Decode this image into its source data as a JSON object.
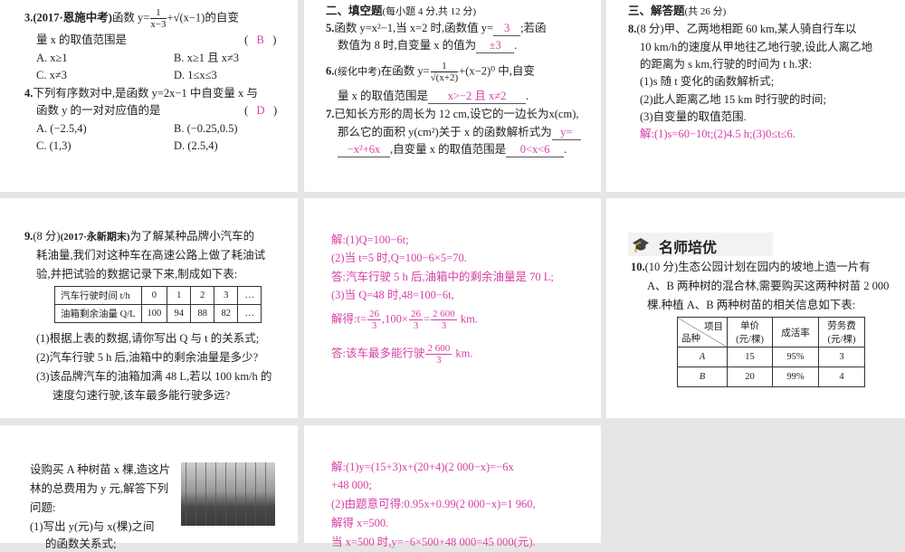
{
  "q3": {
    "head": "3.",
    "src": "(2017·恩施中考)",
    "stem1a": "函数 y=",
    "num": "1",
    "den": "x−3",
    "stem1b": "+√(x−1)的自变",
    "stem2": "量 x 的取值范围是",
    "answer": "B",
    "optA": "A. x≥1",
    "optB": "B. x≥1 且 x≠3",
    "optC": "C. x≠3",
    "optD": "D. 1≤x≤3"
  },
  "q4": {
    "head": "4.",
    "stem1": "下列有序数对中,是函数 y=2x−1 中自变量 x 与",
    "stem2": "函数 y 的一对对应值的是",
    "answer": "D",
    "optA": "A. (−2.5,4)",
    "optB": "B. (−0.25,0.5)",
    "optC": "C. (1,3)",
    "optD": "D. (2.5,4)"
  },
  "sec2": {
    "title": "二、填空题",
    "note": "(每小题 4 分,共 12 分)"
  },
  "q5": {
    "head": "5.",
    "l1a": "函数 y=x²−1,当 x=2 时,函数值 y=",
    "a1": "3",
    "l1b": ";若函",
    "l2a": "数值为 8 时,自变量 x 的值为",
    "a2": "±3",
    "l2b": "."
  },
  "q6": {
    "head": "6.",
    "src": "(绥化中考)",
    "l1a": "在函数 y=",
    "num": "1",
    "den": "√(x+2)",
    "l1b": "+(x−2)⁰ 中,自变",
    "l2a": "量 x 的取值范围是",
    "a1": "x>−2 且 x≠2",
    "l2b": "."
  },
  "q7": {
    "head": "7.",
    "l1": "已知长方形的周长为 12 cm,设它的一边长为x(cm),",
    "l2a": "那么它的面积 y(cm²)关于 x 的函数解析式为",
    "a1a": "y=",
    "a1b": "−x²+6x",
    "l3b": ",自变量 x 的取值范围是",
    "a2": "0<x<6",
    "l3c": "."
  },
  "sec3": {
    "title": "三、解答题",
    "note": "(共 26 分)"
  },
  "q8": {
    "head": "8.",
    "l1": "(8 分)甲、乙两地相距 60 km,某人骑自行车以",
    "l2": "10 km/h的速度从甲地往乙地行驶,设此人离乙地",
    "l3": "的距离为 s km,行驶的时间为 t h.求:",
    "p1": "(1)s 随 t 变化的函数解析式;",
    "p2": "(2)此人距离乙地 15 km 时行驶的时间;",
    "p3": "(3)自变量的取值范围.",
    "sol": "解:(1)s=60−10t;(2)4.5 h;(3)0≤t≤6."
  },
  "q9": {
    "head": "9.",
    "l1a": "(8 分)",
    "src": "(2017·永新期末)",
    "l1b": "为了解某种品牌小汽车的",
    "l2": "耗油量,我们对这种车在高速公路上做了耗油试",
    "l3": "验,并把试验的数据记录下来,制成如下表:",
    "table": {
      "row1": [
        "汽车行驶时间 t/h",
        "0",
        "1",
        "2",
        "3",
        "…"
      ],
      "row2": [
        "油箱剩余油量 Q/L",
        "100",
        "94",
        "88",
        "82",
        "…"
      ]
    },
    "p1": "(1)根据上表的数据,请你写出 Q 与 t 的关系式;",
    "p2": "(2)汽车行驶 5 h 后,油箱中的剩余油量是多少?",
    "p3": "(3)该品牌汽车的油箱加满 48 L,若以 100 km/h 的",
    "p3b": "速度匀速行驶,该车最多能行驶多远?"
  },
  "sol9": {
    "l1": "解:(1)Q=100−6t;",
    "l2": "(2)当 t=5 时,Q=100−6×5=70.",
    "l3": "答:汽车行驶 5 h 后,油箱中的剩余油量是 70 L;",
    "l4": "(3)当 Q=48 时,48=100−6t,",
    "l5a": "解得:t=",
    "n1": "26",
    "d1": "3",
    "l5b": ",100×",
    "n2": "26",
    "d2": "3",
    "l5c": "=",
    "n3": "2 600",
    "d3": "3",
    "l5d": " km.",
    "l6a": "答:该车最多能行驶",
    "n4": "2 600",
    "d4": "3",
    "l6b": " km."
  },
  "banner": "名师培优",
  "q10": {
    "head": "10.",
    "l1": "(10 分)生态公园计划在园内的坡地上造一片有",
    "l2": "A、B 两种树的混合林,需要购买这两种树苗 2 000",
    "l3": "棵.种植 A、B 两种树苗的相关信息如下表:",
    "table": {
      "corner_top": "项目",
      "corner_bottom": "品种",
      "h1a": "单价",
      "h1b": "(元/棵)",
      "h2": "成活率",
      "h3a": "劳务费",
      "h3b": "(元/棵)",
      "rows": [
        [
          "A",
          "15",
          "95%",
          "3"
        ],
        [
          "B",
          "20",
          "99%",
          "4"
        ]
      ]
    }
  },
  "q10b": {
    "l1": "设购买 A 种树苗 x 棵,造这片",
    "l2": "林的总费用为 y 元,解答下列",
    "l3": "问题:",
    "l4": "(1)写出 y(元)与 x(棵)之间",
    "l5": "的函数关系式;"
  },
  "sol10": {
    "l1": "解:(1)y=(15+3)x+(20+4)(2 000−x)=−6x",
    "l2": "+48 000;",
    "l3": "(2)由题意可得:0.95x+0.99(2 000−x)=1 960,",
    "l4": "解得 x=500.",
    "l5": "当 x=500 时,y=−6×500+48 000=45 000(元)."
  }
}
